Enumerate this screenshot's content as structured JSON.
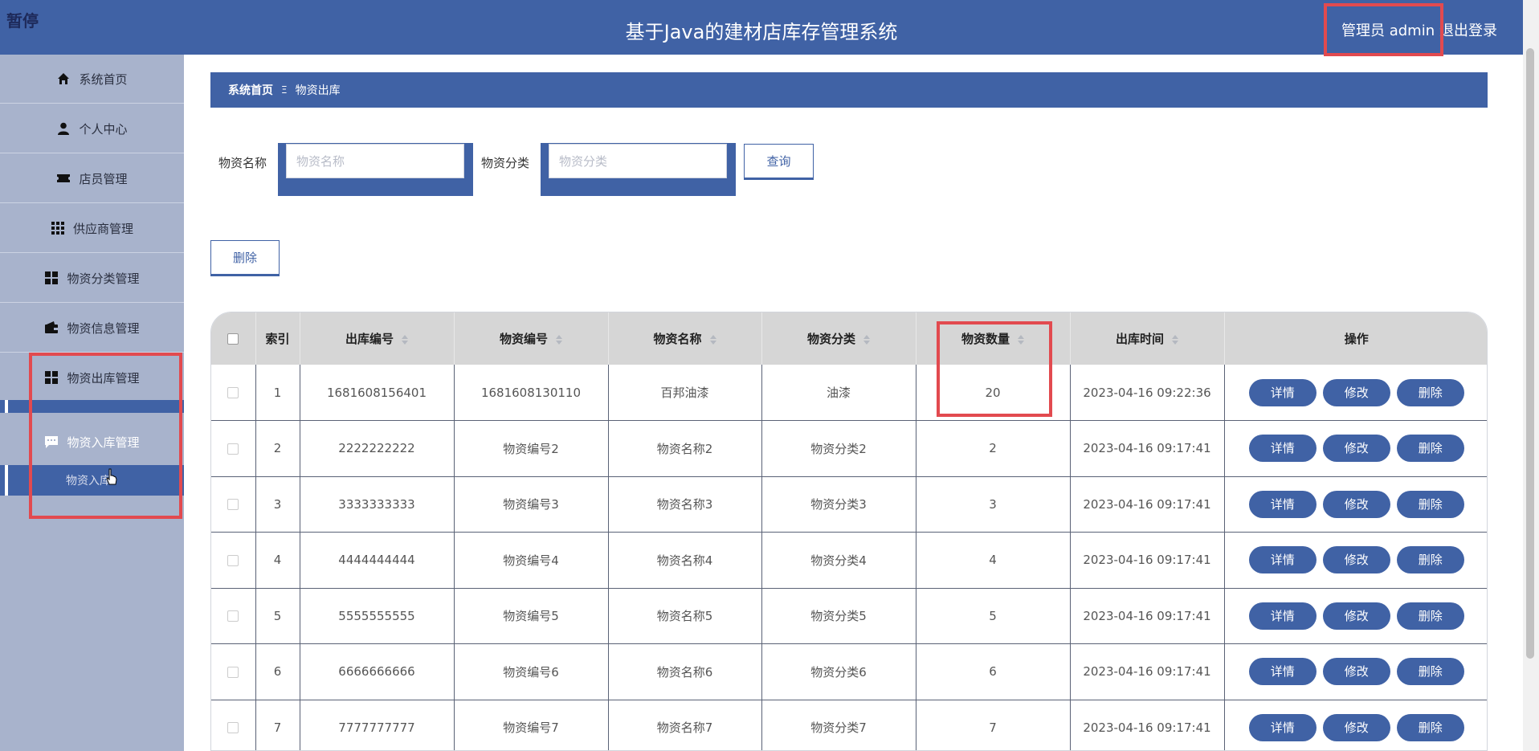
{
  "header": {
    "pause_label": "暂停",
    "app_title": "基于Java的建材店库存管理系统",
    "admin_label": "管理员 admin",
    "logout_label": "退出登录"
  },
  "sidebar": {
    "items": [
      {
        "label": "系统首页",
        "icon": "home-icon"
      },
      {
        "label": "个人中心",
        "icon": "user-icon"
      },
      {
        "label": "店员管理",
        "icon": "ticket-icon"
      },
      {
        "label": "供应商管理",
        "icon": "apps-grid-icon"
      },
      {
        "label": "物资分类管理",
        "icon": "grid-icon"
      },
      {
        "label": "物资信息管理",
        "icon": "wallet-icon"
      },
      {
        "label": "物资出库管理",
        "icon": "grid-icon"
      },
      {
        "label": "物资入库管理",
        "icon": "chat-icon"
      }
    ],
    "sub_item_label": "物资入库"
  },
  "breadcrumb": {
    "home": "系统首页",
    "separator": "Ξ",
    "current": "物资出库"
  },
  "search": {
    "name_label": "物资名称",
    "name_placeholder": "物资名称",
    "category_label": "物资分类",
    "category_placeholder": "物资分类",
    "query_label": "查询"
  },
  "actions": {
    "delete_label": "删除"
  },
  "table": {
    "columns": [
      "索引",
      "出库编号",
      "物资编号",
      "物资名称",
      "物资分类",
      "物资数量",
      "出库时间",
      "操作"
    ],
    "sortable": [
      false,
      true,
      true,
      true,
      true,
      true,
      true,
      false
    ],
    "rows": [
      {
        "index": "1",
        "out_no": "1681608156401",
        "item_no": "1681608130110",
        "name": "百邦油漆",
        "category": "油漆",
        "qty": "20",
        "time": "2023-04-16 09:22:36"
      },
      {
        "index": "2",
        "out_no": "2222222222",
        "item_no": "物资编号2",
        "name": "物资名称2",
        "category": "物资分类2",
        "qty": "2",
        "time": "2023-04-16 09:17:41"
      },
      {
        "index": "3",
        "out_no": "3333333333",
        "item_no": "物资编号3",
        "name": "物资名称3",
        "category": "物资分类3",
        "qty": "3",
        "time": "2023-04-16 09:17:41"
      },
      {
        "index": "4",
        "out_no": "4444444444",
        "item_no": "物资编号4",
        "name": "物资名称4",
        "category": "物资分类4",
        "qty": "4",
        "time": "2023-04-16 09:17:41"
      },
      {
        "index": "5",
        "out_no": "5555555555",
        "item_no": "物资编号5",
        "name": "物资名称5",
        "category": "物资分类5",
        "qty": "5",
        "time": "2023-04-16 09:17:41"
      },
      {
        "index": "6",
        "out_no": "6666666666",
        "item_no": "物资编号6",
        "name": "物资名称6",
        "category": "物资分类6",
        "qty": "6",
        "time": "2023-04-16 09:17:41"
      },
      {
        "index": "7",
        "out_no": "7777777777",
        "item_no": "物资编号7",
        "name": "物资名称7",
        "category": "物资分类7",
        "qty": "7",
        "time": "2023-04-16 09:17:41"
      }
    ],
    "row_buttons": {
      "detail": "详情",
      "edit": "修改",
      "delete": "删除"
    }
  },
  "colors": {
    "primary": "#4062a5",
    "sidebar_bg": "#a8b3cc",
    "highlight": "#e24a4f",
    "header_row": "#d6d6d6"
  }
}
